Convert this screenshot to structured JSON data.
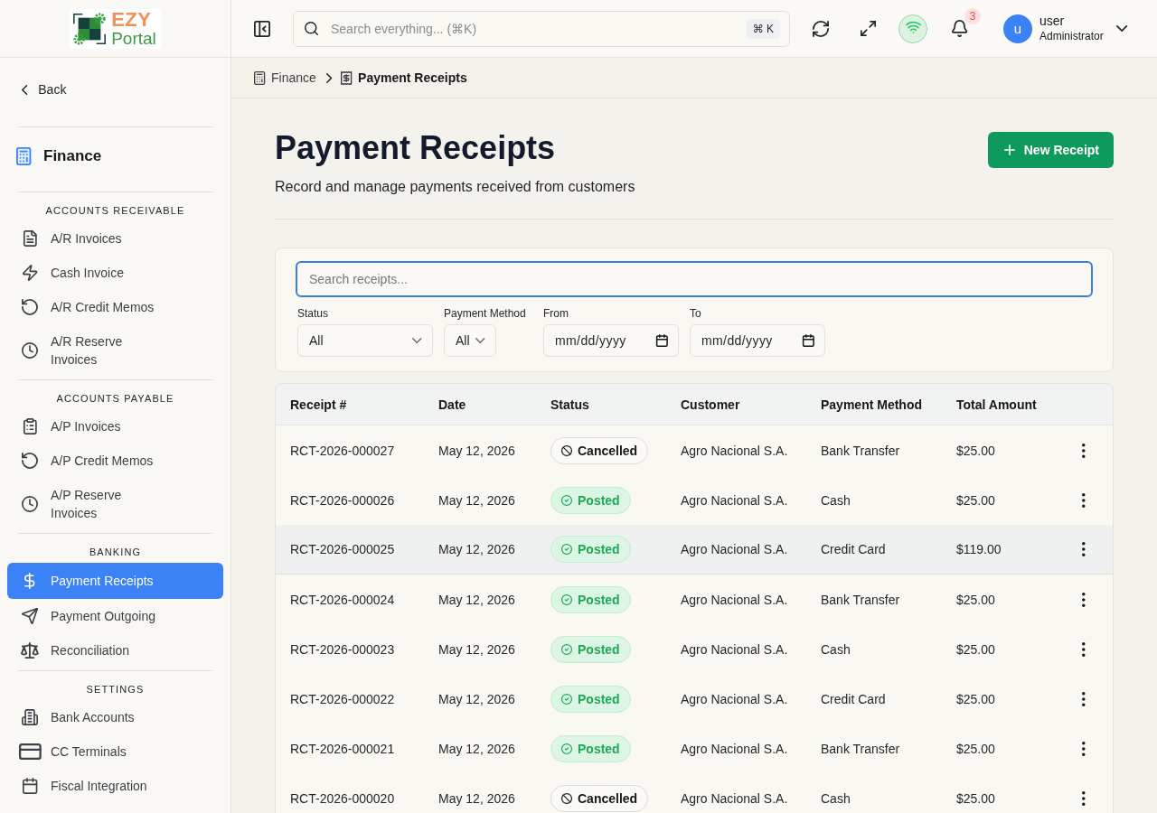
{
  "logo": {
    "brand": "EZY",
    "product": "Portal"
  },
  "sidebar": {
    "back": "Back",
    "module": "Finance",
    "sections": [
      {
        "title": "ACCOUNTS RECEIVABLE",
        "items": [
          {
            "label": "A/R Invoices",
            "selected": false
          },
          {
            "label": "Cash Invoice",
            "selected": false
          },
          {
            "label": "A/R Credit Memos",
            "selected": false
          },
          {
            "label": "A/R Reserve Invoices",
            "selected": false
          }
        ]
      },
      {
        "title": "ACCOUNTS PAYABLE",
        "items": [
          {
            "label": "A/P Invoices",
            "selected": false
          },
          {
            "label": "A/P Credit Memos",
            "selected": false
          },
          {
            "label": "A/P Reserve Invoices",
            "selected": false
          }
        ]
      },
      {
        "title": "BANKING",
        "items": [
          {
            "label": "Payment Receipts",
            "selected": true
          },
          {
            "label": "Payment Outgoing",
            "selected": false
          },
          {
            "label": "Reconciliation",
            "selected": false
          }
        ]
      },
      {
        "title": "SETTINGS",
        "items": [
          {
            "label": "Bank Accounts",
            "selected": false
          },
          {
            "label": "CC Terminals",
            "selected": false
          },
          {
            "label": "Fiscal Integration",
            "selected": false
          }
        ]
      }
    ]
  },
  "topbar": {
    "search": {
      "placeholder": "Search everything... (⌘K)",
      "shortcut": "⌘ K"
    },
    "connection": {
      "online": true
    },
    "notifications": {
      "count": "3"
    },
    "user": {
      "initial": "u",
      "name": "user",
      "role": "Administrator"
    }
  },
  "breadcrumb": [
    {
      "label": "Finance",
      "current": false
    },
    {
      "label": "Payment Receipts",
      "current": true
    }
  ],
  "page": {
    "title": "Payment Receipts",
    "subtitle": "Record and manage payments received from customers",
    "action": "New Receipt"
  },
  "filters": {
    "search": {
      "placeholder": "Search receipts...",
      "focused": true
    },
    "fields": [
      {
        "kind": "select",
        "label": "Status",
        "value": "All"
      },
      {
        "kind": "select",
        "label": "Payment Method",
        "value": "All"
      },
      {
        "kind": "date",
        "label": "From",
        "placeholder": "mm/dd/yyyy"
      },
      {
        "kind": "date",
        "label": "To",
        "placeholder": "mm/dd/yyyy"
      }
    ]
  },
  "table": {
    "columns": [
      "Receipt #",
      "Date",
      "Status",
      "Customer",
      "Payment Method",
      "Total Amount"
    ],
    "rows": [
      {
        "receipt": "RCT-2026-000027",
        "date": "May 12, 2026",
        "status": {
          "label": "Cancelled",
          "kind": "cancelled"
        },
        "customer": "Agro Nacional S.A.",
        "method": "Bank Transfer",
        "total": "$25.00",
        "highlighted": false
      },
      {
        "receipt": "RCT-2026-000026",
        "date": "May 12, 2026",
        "status": {
          "label": "Posted",
          "kind": "posted"
        },
        "customer": "Agro Nacional S.A.",
        "method": "Cash",
        "total": "$25.00",
        "highlighted": false
      },
      {
        "receipt": "RCT-2026-000025",
        "date": "May 12, 2026",
        "status": {
          "label": "Posted",
          "kind": "posted"
        },
        "customer": "Agro Nacional S.A.",
        "method": "Credit Card",
        "total": "$119.00",
        "highlighted": true
      },
      {
        "receipt": "RCT-2026-000024",
        "date": "May 12, 2026",
        "status": {
          "label": "Posted",
          "kind": "posted"
        },
        "customer": "Agro Nacional S.A.",
        "method": "Bank Transfer",
        "total": "$25.00",
        "highlighted": false
      },
      {
        "receipt": "RCT-2026-000023",
        "date": "May 12, 2026",
        "status": {
          "label": "Posted",
          "kind": "posted"
        },
        "customer": "Agro Nacional S.A.",
        "method": "Cash",
        "total": "$25.00",
        "highlighted": false
      },
      {
        "receipt": "RCT-2026-000022",
        "date": "May 12, 2026",
        "status": {
          "label": "Posted",
          "kind": "posted"
        },
        "customer": "Agro Nacional S.A.",
        "method": "Credit Card",
        "total": "$25.00",
        "highlighted": false
      },
      {
        "receipt": "RCT-2026-000021",
        "date": "May 12, 2026",
        "status": {
          "label": "Posted",
          "kind": "posted"
        },
        "customer": "Agro Nacional S.A.",
        "method": "Bank Transfer",
        "total": "$25.00",
        "highlighted": false
      },
      {
        "receipt": "RCT-2026-000020",
        "date": "May 12, 2026",
        "status": {
          "label": "Cancelled",
          "kind": "cancelled"
        },
        "customer": "Agro Nacional S.A.",
        "method": "Cash",
        "total": "$25.00",
        "highlighted": false
      }
    ]
  }
}
